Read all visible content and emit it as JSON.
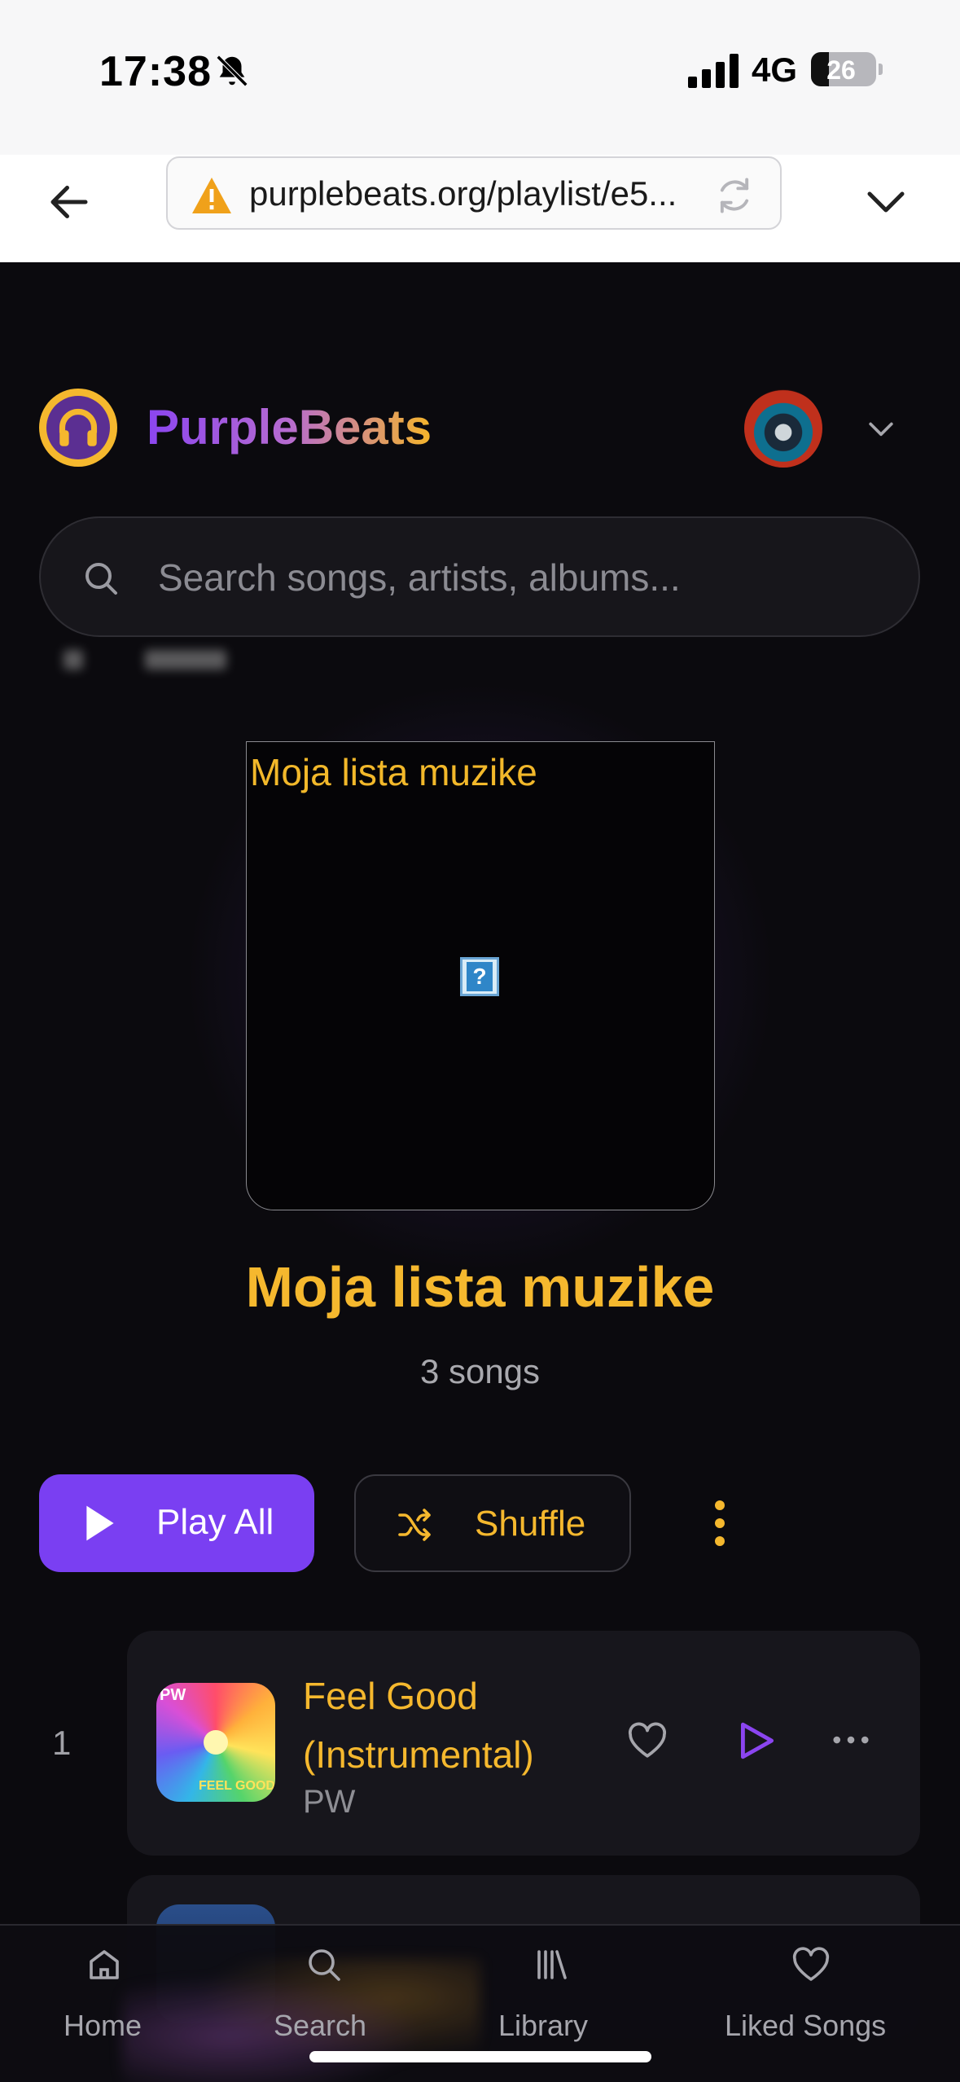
{
  "status_bar": {
    "time": "17:38",
    "network": "4G",
    "battery": "26"
  },
  "browser": {
    "url": "purplebeats.org/playlist/e5..."
  },
  "app": {
    "brand": "PurpleBeats"
  },
  "search": {
    "placeholder": "Search songs, artists, albums..."
  },
  "playlist": {
    "cover_alt": "Moja lista muzike",
    "title": "Moja lista muzike",
    "count": "3 songs"
  },
  "actions": {
    "play_all": "Play All",
    "shuffle": "Shuffle"
  },
  "tracks": [
    {
      "number": "1",
      "title": "Feel Good (Instrumental)",
      "artist": "PW"
    }
  ],
  "nav": {
    "items": [
      {
        "label": "Home",
        "icon": "home-icon"
      },
      {
        "label": "Search",
        "icon": "search-icon"
      },
      {
        "label": "Library",
        "icon": "library-icon"
      },
      {
        "label": "Liked Songs",
        "icon": "heart-icon"
      }
    ]
  },
  "colors": {
    "accent_purple": "#7a3ff2",
    "accent_gold": "#f5b82e",
    "background": "#0b0a0e"
  }
}
